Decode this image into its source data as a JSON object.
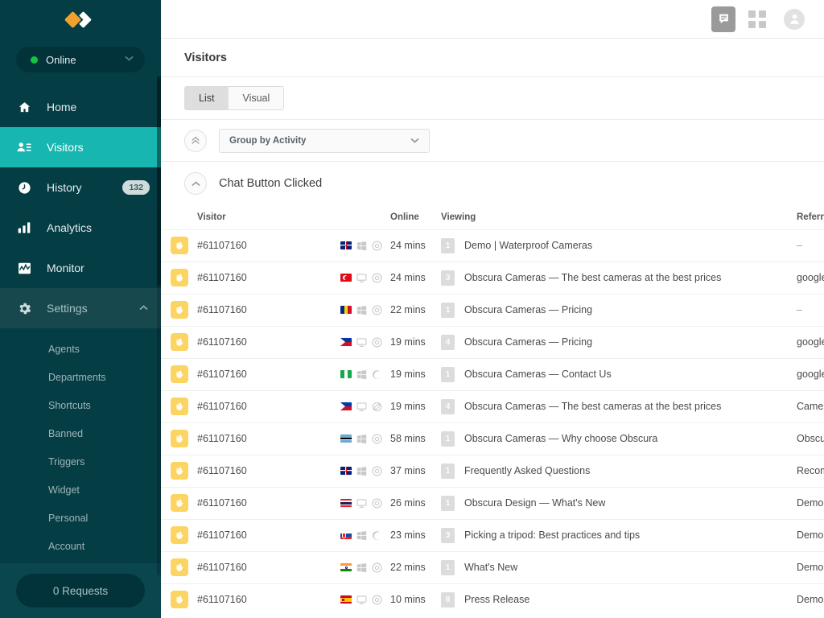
{
  "sidebar": {
    "logo": "obscura-diamond-logo",
    "status": {
      "label": "Online",
      "indicator_color": "#13c344",
      "caret": "chevron-down-icon"
    },
    "nav": [
      {
        "id": "home",
        "icon": "home-icon",
        "label": "Home",
        "badge": null,
        "active": false
      },
      {
        "id": "visitors",
        "icon": "visitors-icon",
        "label": "Visitors",
        "badge": null,
        "active": true
      },
      {
        "id": "history",
        "icon": "clock-icon",
        "label": "History",
        "badge": "132",
        "active": false
      },
      {
        "id": "analytics",
        "icon": "bar-chart-icon",
        "label": "Analytics",
        "badge": null,
        "active": false
      },
      {
        "id": "monitor",
        "icon": "monitor-icon",
        "label": "Monitor",
        "badge": null,
        "active": false
      },
      {
        "id": "settings",
        "icon": "gear-icon",
        "label": "Settings",
        "badge": null,
        "active": false,
        "expanded": true,
        "caret": "chevron-up-icon"
      }
    ],
    "submenu": [
      {
        "id": "agents",
        "label": "Agents"
      },
      {
        "id": "departments",
        "label": "Departments"
      },
      {
        "id": "shortcuts",
        "label": "Shortcuts"
      },
      {
        "id": "banned",
        "label": "Banned"
      },
      {
        "id": "triggers",
        "label": "Triggers"
      },
      {
        "id": "widget",
        "label": "Widget"
      },
      {
        "id": "personal",
        "label": "Personal"
      },
      {
        "id": "account",
        "label": "Account"
      }
    ],
    "footer": {
      "requests_label": "0 Requests"
    },
    "accent_color": "#18b6b0",
    "background_color": "#053d44"
  },
  "topbar": {
    "chat_icon": "chat-bubble-icon",
    "apps_icon": "apps-grid-icon",
    "avatar_icon": "user-avatar-icon"
  },
  "page": {
    "title": "Visitors"
  },
  "view_tabs": [
    {
      "id": "list",
      "label": "List",
      "selected": true
    },
    {
      "id": "visual",
      "label": "Visual",
      "selected": false
    }
  ],
  "filter": {
    "collapse_icon": "double-chevron-up-icon",
    "group_by": {
      "label": "Group by Activity",
      "caret": "chevron-down-icon"
    }
  },
  "group": {
    "toggle_icon": "chevron-up-icon",
    "title": "Chat Button Clicked"
  },
  "table": {
    "columns": [
      "Visitor",
      "Online",
      "Viewing",
      "Referrer"
    ],
    "rows": [
      {
        "visitor": "#61107160",
        "flag": "gb",
        "os": "windows",
        "browser": "chrome",
        "online": "24 mins",
        "pages": "1",
        "viewing": "Demo | Waterproof Cameras",
        "referrer": "–"
      },
      {
        "visitor": "#61107160",
        "flag": "tr",
        "os": "desktop",
        "browser": "chrome",
        "online": "24 mins",
        "pages": "3",
        "viewing": "Obscura Cameras — The best cameras at the best prices",
        "referrer": "google"
      },
      {
        "visitor": "#61107160",
        "flag": "ro",
        "os": "windows",
        "browser": "chrome",
        "online": "22 mins",
        "pages": "1",
        "viewing": "Obscura Cameras — Pricing",
        "referrer": "–"
      },
      {
        "visitor": "#61107160",
        "flag": "ph",
        "os": "desktop",
        "browser": "chrome",
        "online": "19 mins",
        "pages": "4",
        "viewing": "Obscura Cameras — Pricing",
        "referrer": "google"
      },
      {
        "visitor": "#61107160",
        "flag": "ng",
        "os": "windows",
        "browser": "firefox",
        "online": "19 mins",
        "pages": "1",
        "viewing": "Obscura Cameras — Contact Us",
        "referrer": "google"
      },
      {
        "visitor": "#61107160",
        "flag": "ph",
        "os": "desktop",
        "browser": "opera",
        "online": "19 mins",
        "pages": "4",
        "viewing": "Obscura Cameras — The best cameras at the best prices",
        "referrer": "Came"
      },
      {
        "visitor": "#61107160",
        "flag": "bw",
        "os": "windows",
        "browser": "chrome",
        "online": "58 mins",
        "pages": "1",
        "viewing": "Obscura Cameras — Why choose Obscura",
        "referrer": "Obscu"
      },
      {
        "visitor": "#61107160",
        "flag": "gb",
        "os": "windows",
        "browser": "chrome",
        "online": "37 mins",
        "pages": "1",
        "viewing": "Frequently Asked Questions",
        "referrer": "Recom"
      },
      {
        "visitor": "#61107160",
        "flag": "th",
        "os": "desktop",
        "browser": "chrome",
        "online": "26 mins",
        "pages": "1",
        "viewing": "Obscura Design — What's New",
        "referrer": "Demo"
      },
      {
        "visitor": "#61107160",
        "flag": "sk",
        "os": "windows",
        "browser": "firefox",
        "online": "23 mins",
        "pages": "3",
        "viewing": "Picking a tripod: Best practices and tips",
        "referrer": "Demo"
      },
      {
        "visitor": "#61107160",
        "flag": "in",
        "os": "windows",
        "browser": "chrome",
        "online": "22 mins",
        "pages": "1",
        "viewing": "What's New",
        "referrer": "Demo"
      },
      {
        "visitor": "#61107160",
        "flag": "es",
        "os": "desktop",
        "browser": "chrome",
        "online": "10 mins",
        "pages": "8",
        "viewing": "Press Release",
        "referrer": "Demo"
      }
    ]
  }
}
